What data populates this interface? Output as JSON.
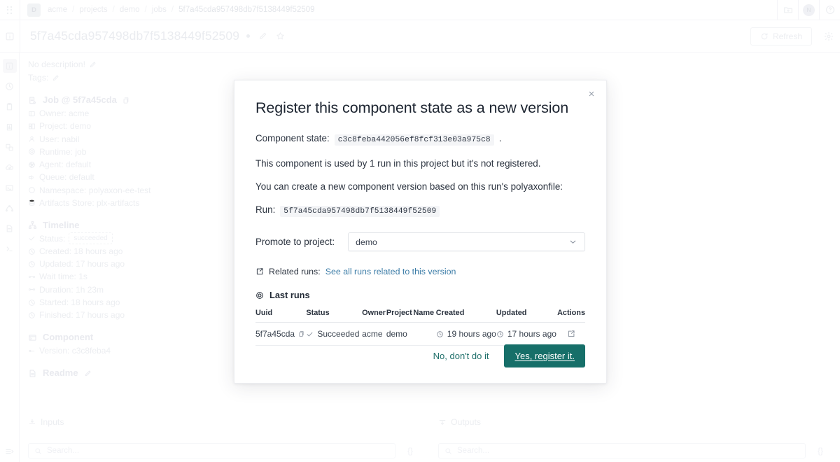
{
  "colors": {
    "primary_button_bg": "#166f69",
    "link_blue": "#3b7ca7",
    "secondary_text": "#1f6f6a",
    "faded_ui": "#e7e9ee"
  },
  "topbar": {
    "org_initial": "D",
    "breadcrumbs": [
      "acme",
      "projects",
      "demo",
      "jobs",
      "5f7a45cda957498db7f5138449f52509"
    ],
    "separator": "/",
    "actions": [
      "new-folder-icon",
      "user-avatar",
      "help-icon"
    ],
    "avatar_initial": "N"
  },
  "titlebar": {
    "title": "5f7a45cda957498db7f5138449f52509",
    "refresh_label": "Refresh",
    "icons": [
      "live-dot",
      "edit-icon",
      "star-icon",
      "refresh-icon",
      "gear-icon"
    ]
  },
  "rail": {
    "items": [
      {
        "name": "overview-icon",
        "active": true
      },
      {
        "name": "history-icon",
        "active": false
      },
      {
        "name": "clipboard-icon",
        "active": false
      },
      {
        "name": "chart-icon",
        "active": false
      },
      {
        "name": "lineage-icon",
        "active": false
      },
      {
        "name": "cloud-activity-icon",
        "active": false
      },
      {
        "name": "terminal-panel-icon",
        "active": false
      },
      {
        "name": "graph-icon",
        "active": false
      },
      {
        "name": "file-icon",
        "active": false
      },
      {
        "name": "shell-icon",
        "active": false
      }
    ],
    "bottom_item": "collapse-sidebar-icon"
  },
  "detail": {
    "description": "No description!",
    "tags_label": "Tags:",
    "job_header": "Job @ 5f7a45cda",
    "meta": [
      {
        "icon": "owner-icon",
        "text": "Owner: acme"
      },
      {
        "icon": "project-icon",
        "text": "Project: demo"
      },
      {
        "icon": "user-icon",
        "text": "User: nabil"
      },
      {
        "icon": "runtime-icon",
        "text": "Runtime: job"
      },
      {
        "icon": "agent-icon",
        "text": "Agent: default"
      },
      {
        "icon": "queue-icon",
        "text": "Queue: default"
      },
      {
        "icon": "namespace-icon",
        "text": "Namespace: polyaxon-ee-test"
      },
      {
        "icon": "artifacts-store-icon",
        "text": "Artifacts Store: plx-artifacts"
      }
    ],
    "timeline_title": "Timeline",
    "status_label": "Status:",
    "status_value": "succeeded",
    "timeline": [
      {
        "icon": "clock-icon",
        "text": "Created: 18 hours ago"
      },
      {
        "icon": "clock-icon",
        "text": "Updated: 17 hours ago"
      },
      {
        "icon": "duration-icon",
        "text": "Wait time: 1s"
      },
      {
        "icon": "duration-icon",
        "text": "Duration: 1h 23m"
      },
      {
        "icon": "clock-icon",
        "text": "Started: 18 hours ago"
      },
      {
        "icon": "clock-icon",
        "text": "Finished: 17 hours ago"
      }
    ],
    "component_title": "Component",
    "component_version": "Version: c3c8feba4",
    "readme_title": "Readme"
  },
  "io": {
    "inputs_label": "Inputs",
    "outputs_label": "Outputs",
    "search_placeholder": "Search...",
    "json_toggle": "{}"
  },
  "modal": {
    "title": "Register this component state as a new version",
    "close_icon": "×",
    "component_state_label": "Component state:",
    "component_state_value": "c3c8feba442056ef8fcf313e03a975c8",
    "component_state_period": ".",
    "usage_line": "This component is used by 1 run in this project but it's not registered.",
    "create_line": "You can create a new component version based on this run's polyaxonfile:",
    "run_label": "Run:",
    "run_value": "5f7a45cda957498db7f5138449f52509",
    "promote_label": "Promote to project:",
    "promote_value": "demo",
    "promote_options": [
      "demo"
    ],
    "related_runs_label": "Related runs:",
    "related_runs_link": "See all runs related to this version",
    "last_runs_title": "Last runs",
    "table": {
      "headers": [
        "Uuid",
        "Status",
        "Owner",
        "Project",
        "Name",
        "Created",
        "Updated",
        "Actions"
      ],
      "rows": [
        {
          "uuid": "5f7a45cda",
          "status": "Succeeded",
          "owner": "acme",
          "project": "demo",
          "name": "",
          "created": "19 hours ago",
          "updated": "17 hours ago",
          "action_icon": "external-link-icon"
        }
      ]
    },
    "cancel_label": "No, don't do it",
    "confirm_label": "Yes, register it."
  }
}
